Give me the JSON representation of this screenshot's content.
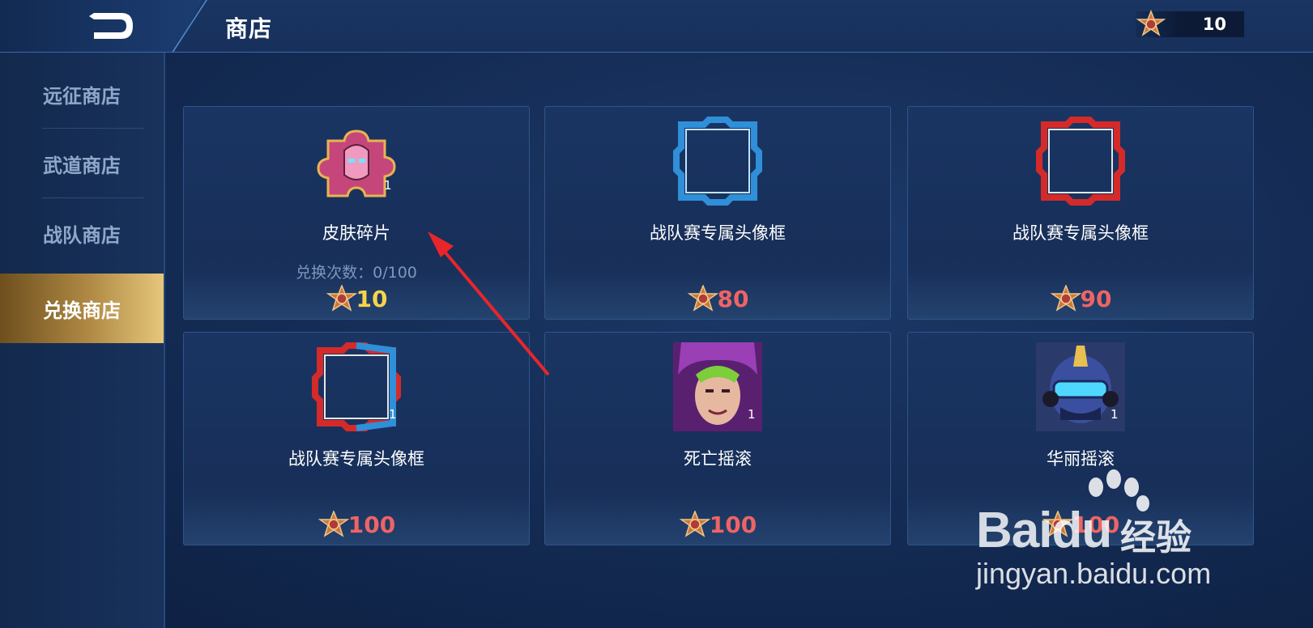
{
  "header": {
    "title": "商店",
    "currency_value": "10"
  },
  "sidebar": {
    "items": [
      {
        "label": "远征商店",
        "active": false
      },
      {
        "label": "武道商店",
        "active": false
      },
      {
        "label": "战队商店",
        "active": false
      },
      {
        "label": "兑换商店",
        "active": true
      }
    ]
  },
  "items": [
    {
      "name": "皮肤碎片",
      "icon": "skin-fragment-icon",
      "quantity": "1",
      "limit": "兑换次数：0/100",
      "price": "10",
      "price_color": "#f7d34a"
    },
    {
      "name": "战队赛专属头像框",
      "icon": "blue-avatar-frame-icon",
      "quantity": "",
      "price": "80",
      "price_color": "#ee6464"
    },
    {
      "name": "战队赛专属头像框",
      "icon": "red-avatar-frame-icon",
      "quantity": "",
      "price": "90",
      "price_color": "#ee6464"
    },
    {
      "name": "战队赛专属头像框",
      "icon": "red-blue-avatar-frame-icon",
      "quantity": "1",
      "price": "100",
      "price_color": "#ee6464"
    },
    {
      "name": "死亡摇滚",
      "icon": "death-rock-skin-icon",
      "quantity": "1",
      "price": "100",
      "price_color": "#ee6464"
    },
    {
      "name": "华丽摇滚",
      "icon": "glamorous-rock-skin-icon",
      "quantity": "1",
      "price": "100",
      "price_color": "#ee6464"
    }
  ],
  "watermark": {
    "brand": "Baidu",
    "cn": "经验",
    "url": "jingyan.baidu.com"
  }
}
